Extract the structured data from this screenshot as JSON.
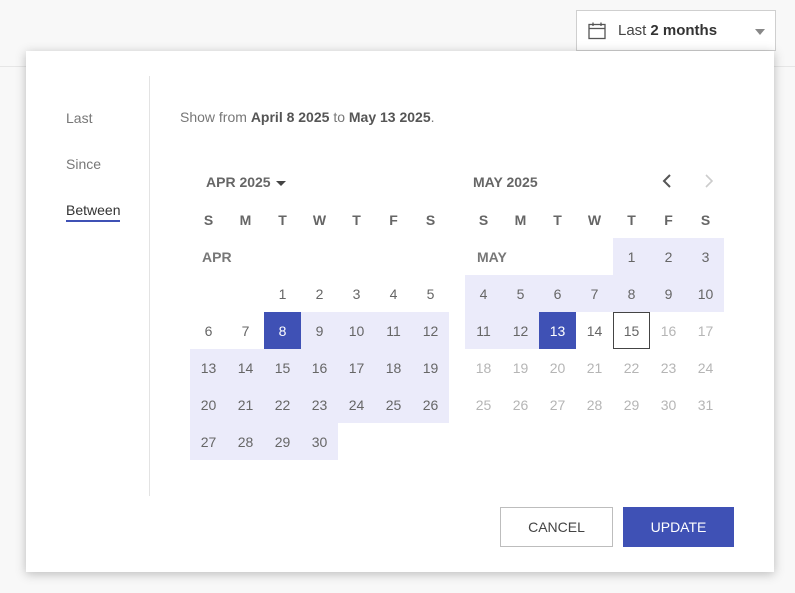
{
  "header": {
    "range_prefix": "Last",
    "range_value": "2 months",
    "calendar_icon": "calendar-icon",
    "dropdown_icon": "caret-down-icon"
  },
  "sidebar": {
    "items": [
      {
        "label": "Last",
        "active": false
      },
      {
        "label": "Since",
        "active": false
      },
      {
        "label": "Between",
        "active": true
      }
    ]
  },
  "summary": {
    "prefix": "Show from",
    "from": "April 8 2025",
    "middle": "to",
    "to": "May 13 2025",
    "suffix": "."
  },
  "weekdays": [
    "S",
    "M",
    "T",
    "W",
    "T",
    "F",
    "S"
  ],
  "months": [
    {
      "title": "APR 2025",
      "has_dropdown": true,
      "label": "APR",
      "first_weekday": 2,
      "days": 30,
      "range_from": 8,
      "range_to": 30,
      "selected": [
        8
      ],
      "today": null,
      "disabled_from": null
    },
    {
      "title": "MAY 2025",
      "has_dropdown": false,
      "label": "MAY",
      "first_weekday": 4,
      "days": 31,
      "range_from": 1,
      "range_to": 13,
      "selected": [
        13
      ],
      "today": 15,
      "disabled_from": 16
    }
  ],
  "nav": {
    "prev_icon": "chevron-left-icon",
    "next_icon": "chevron-right-icon",
    "next_disabled": true
  },
  "actions": {
    "cancel_label": "CANCEL",
    "update_label": "UPDATE"
  },
  "colors": {
    "accent": "#3f51b5",
    "range_fill": "#ebebfa",
    "disabled_text": "#b5b5b5"
  }
}
